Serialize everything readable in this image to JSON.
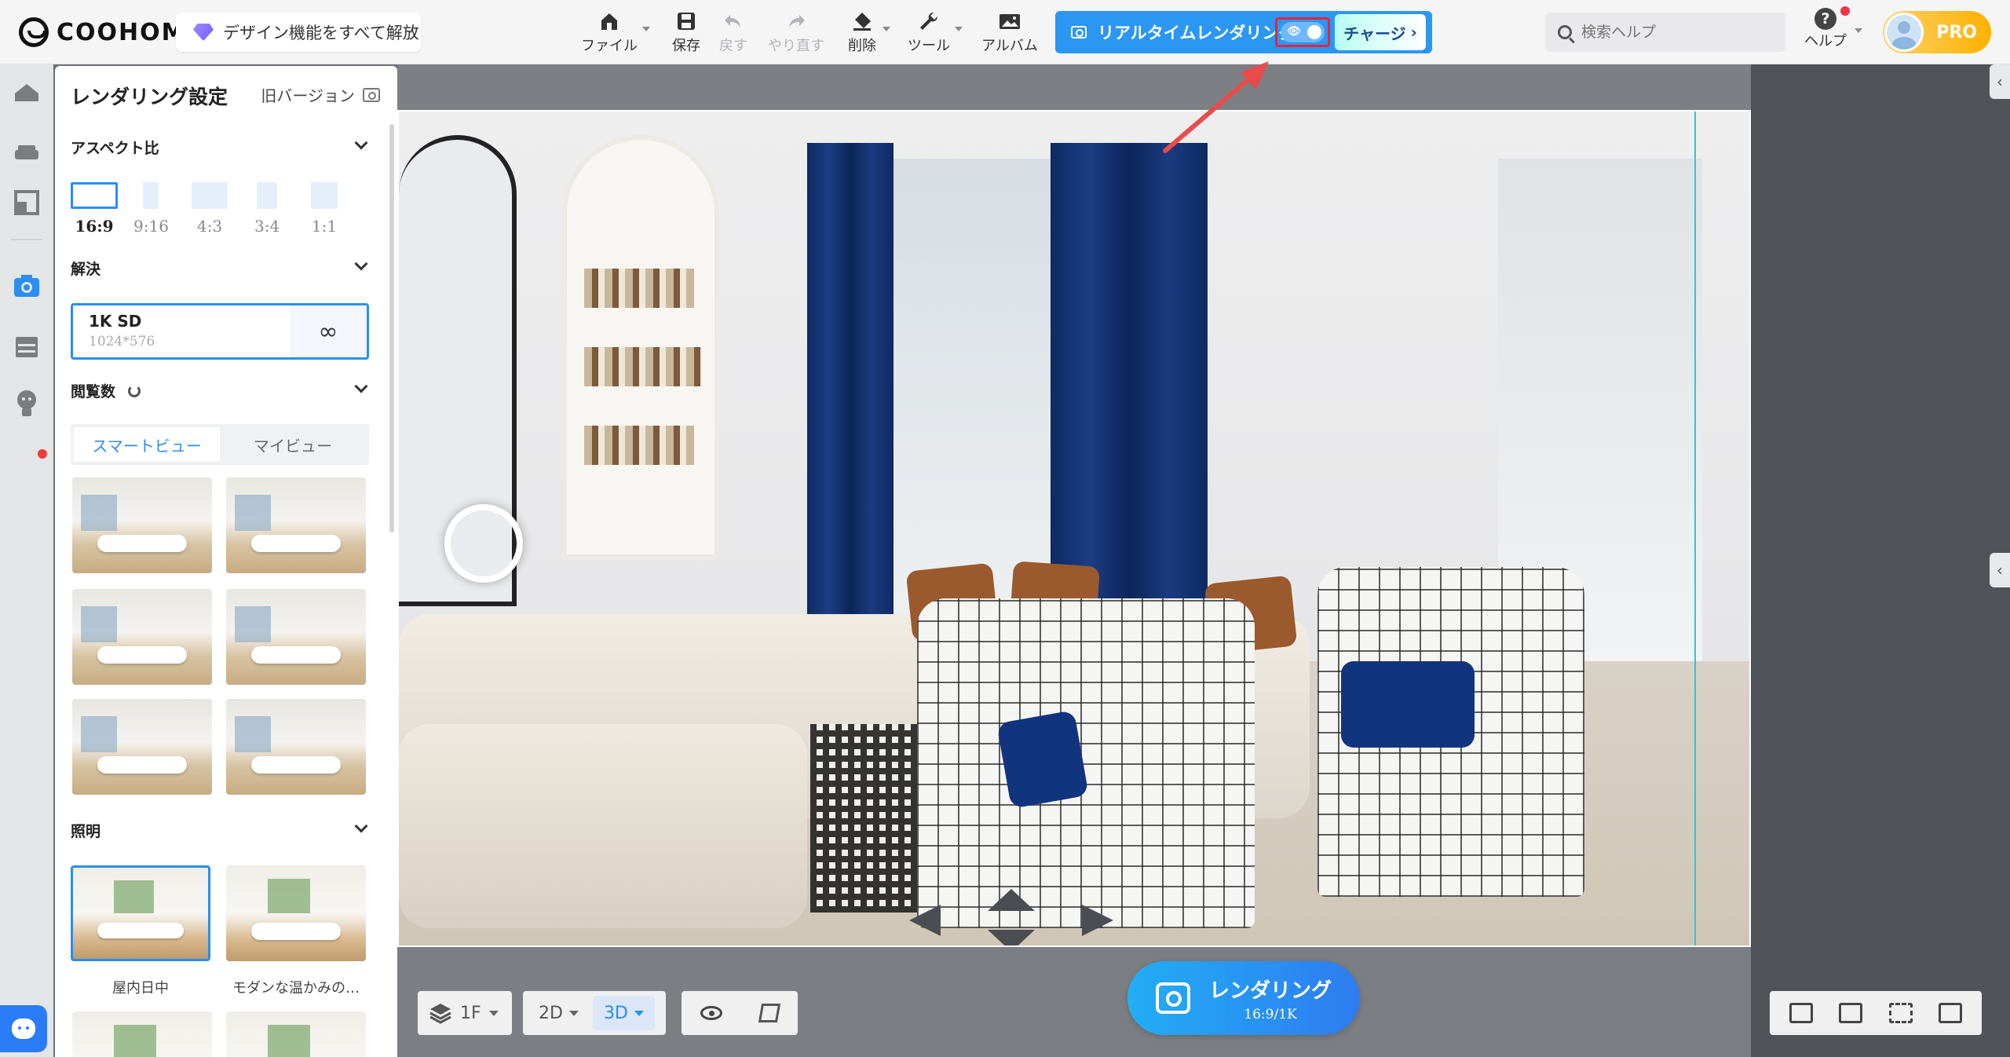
{
  "app": {
    "logo_text": "COOHOM",
    "unlock_label": "デザイン機能をすべて解放"
  },
  "toolbar": {
    "items": [
      {
        "label": "ファイル",
        "icon": "home-icon"
      },
      {
        "label": "保存",
        "icon": "save-icon"
      },
      {
        "label": "戻す",
        "icon": "undo-icon",
        "disabled": true
      },
      {
        "label": "やり直す",
        "icon": "redo-icon",
        "disabled": true
      },
      {
        "label": "削除",
        "icon": "eraser-icon"
      },
      {
        "label": "ツール",
        "icon": "wrench-icon"
      },
      {
        "label": "アルバム",
        "icon": "album-icon"
      }
    ]
  },
  "realtime": {
    "label": "リアルタイムレンダリング",
    "toggle_on": true,
    "charge_label": "チャージ"
  },
  "search": {
    "placeholder": "検索ヘルプ"
  },
  "help": {
    "label": "ヘルプ"
  },
  "account": {
    "badge": "PRO"
  },
  "panel": {
    "title": "レンダリング設定",
    "old_version": "旧バージョン",
    "aspect": {
      "title": "アスペクト比",
      "options": [
        "16:9",
        "9:16",
        "4:3",
        "3:4",
        "1:1"
      ],
      "selected": "16:9"
    },
    "resolution": {
      "title": "解決",
      "value": "1K SD",
      "size": "1024*576"
    },
    "views": {
      "title": "閲覧数",
      "tabs": [
        "スマートビュー",
        "マイビュー"
      ],
      "active_tab": "スマートビュー"
    },
    "lighting": {
      "title": "照明",
      "presets": [
        "屋内日中",
        "モダンな温かみの…"
      ]
    }
  },
  "bottom": {
    "floor": "1F",
    "mode_2d": "2D",
    "mode_3d": "3D",
    "active_mode": "3D",
    "render_label": "レンダリング",
    "render_spec": "16:9/1K"
  },
  "colors": {
    "accent": "#2b8ef0",
    "realtime_bg": "#2b97f3",
    "highlight": "#e4253a",
    "pro": "#ffb100"
  }
}
